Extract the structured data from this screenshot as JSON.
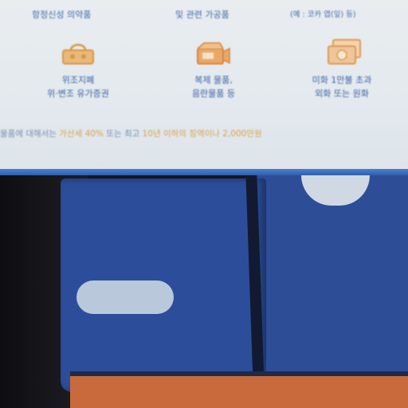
{
  "sign": {
    "top_row": [
      {
        "text": "항정신성 의약품"
      },
      {
        "text": "및 관련 가공품"
      },
      {
        "text": "(예 : 코카 엽(잎) 등)"
      }
    ],
    "items": [
      {
        "icon": "handbag-icon",
        "label_line1": "위조지폐",
        "label_line2": "위·변조 유가증권"
      },
      {
        "icon": "film-camera-icon",
        "label_line1": "복제 물품,",
        "label_line2": "음란물품 등"
      },
      {
        "icon": "banknote-icon",
        "label_line1": "미화 1만불 초과",
        "label_line2": "외화 또는 원화"
      }
    ],
    "note": {
      "prefix": "물품에 대해서는 ",
      "highlight1": "가산세 40%",
      "middle": " 또는 최고 ",
      "highlight2": "10년 이하의 징역이나 2,000만원",
      "suffix": ""
    }
  },
  "colors": {
    "sign_bg": "#e6ebef",
    "text_blue": "#3b62a4",
    "accent_orange": "#d9a24a",
    "cloth_blue": "#2c4d9a",
    "strap_orange": "#c96a3c"
  }
}
